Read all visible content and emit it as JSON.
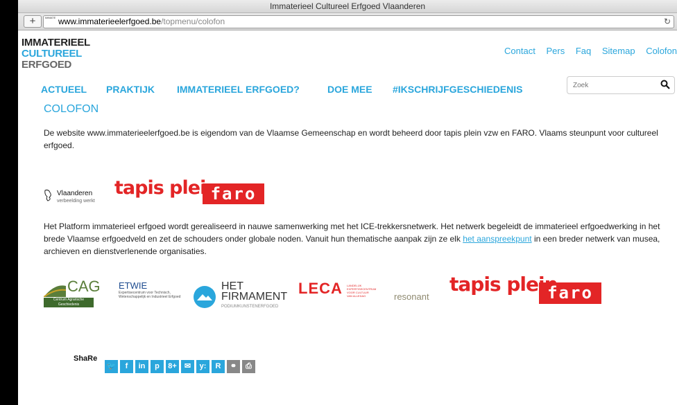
{
  "window": {
    "title": "Immaterieel Cultureel Erfgoed Vlaanderen"
  },
  "browser": {
    "url_host": "www.immaterieelerfgoed.be",
    "url_path": "/topmenu/colofon",
    "new_tab_label": "+",
    "favicon_text": "IMMATERI CULTUREEL ERFGOED"
  },
  "logo": {
    "line1": "IMMATERIEEL",
    "line2": "CULTUREEL",
    "line3": "ERFGOED"
  },
  "topmenu": [
    "Contact",
    "Pers",
    "Faq",
    "Sitemap",
    "Colofon"
  ],
  "mainnav": [
    "ACTUEEL",
    "PRAKTIJK",
    "IMMATERIEEL ERFGOED?",
    "DOE MEE",
    "#IKSCHRIJFGESCHIEDENIS"
  ],
  "search": {
    "placeholder": "Zoek"
  },
  "content": {
    "title": "COLOFON",
    "para1": "De website www.immaterieelerfgoed.be is eigendom van de Vlaamse Gemeenschap en wordt beheerd door tapis plein vzw en FARO. Vlaams steunpunt voor cultureel erfgoed.",
    "para2_before": "Het Platform immaterieel erfgoed wordt gerealiseerd in nauwe samenwerking met het ICE-trekkersnetwerk. Het netwerk begeleidt de immaterieel erfgoedwerking in het brede Vlaamse erfgoedveld en zet de schouders onder globale noden. Vanuit hun thematische aanpak zijn ze elk ",
    "para2_link": "het aanspreekpunt",
    "para2_after": " in een breder netwerk van musea, archieven en dienstverlenende organisaties."
  },
  "logos_row1": {
    "vlaanderen": "Vlaanderen",
    "vlaanderen_sub": "verbeelding werkt",
    "tapis": "tapis plein",
    "faro": "faro"
  },
  "logos_row2": {
    "cag": "CAG",
    "cag_sub": "Centrum Agrarische Geschiedenis",
    "etwie": "ETWIE",
    "etwie_sub": "Expertisecentrum voor Technisch, Wetenschappelijk en Industrieel Erfgoed",
    "het": "HET",
    "firmament": "FIRMAMENT",
    "firmament_sub": "PODIUMKUNSTENERFGOED",
    "leca": "LECA",
    "leca_sub": "LANDELIJK EXPERTISECENTRUM VOOR CULTUUR VAN ALLEDAG",
    "resonant": "resonant",
    "tapis": "tapis plein",
    "faro": "faro"
  },
  "share": {
    "label": "ShaRe",
    "buttons": [
      {
        "icon": "twitter-icon",
        "glyph": "🐦"
      },
      {
        "icon": "facebook-icon",
        "glyph": "f"
      },
      {
        "icon": "linkedin-icon",
        "glyph": "in"
      },
      {
        "icon": "pinterest-icon",
        "glyph": "p"
      },
      {
        "icon": "googleplus-icon",
        "glyph": "8+"
      },
      {
        "icon": "email-icon",
        "glyph": "✉"
      },
      {
        "icon": "yammer-icon",
        "glyph": "y:"
      },
      {
        "icon": "readability-icon",
        "glyph": "R"
      },
      {
        "icon": "link-icon",
        "glyph": "⚭"
      },
      {
        "icon": "print-icon",
        "glyph": "⎙"
      }
    ]
  },
  "colors": {
    "accent": "#2aa6dc",
    "brand_red": "#e32526"
  }
}
